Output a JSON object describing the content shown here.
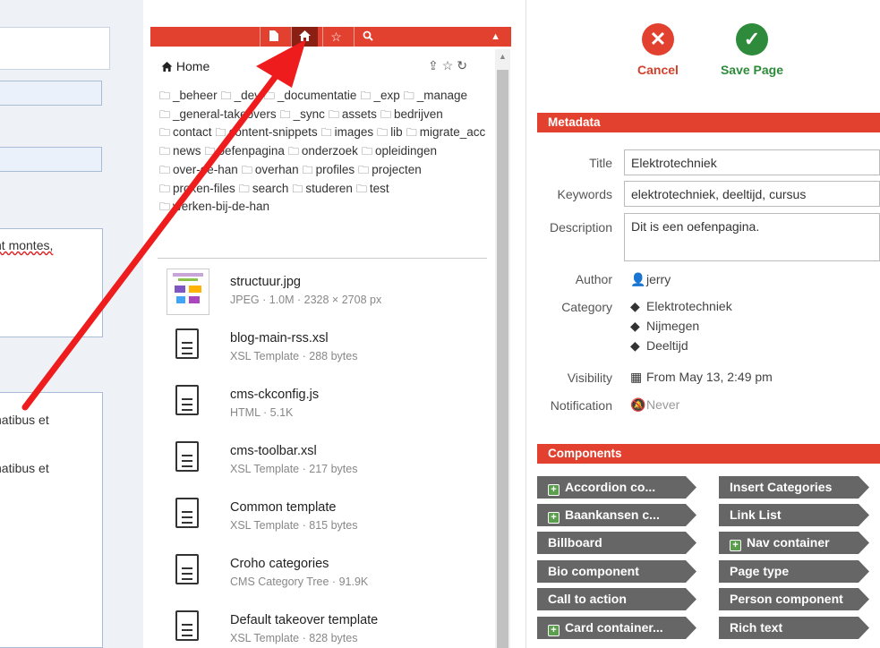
{
  "left_panel": {
    "text_1": "nt montes,",
    "text_2": "natibus et",
    "text_3": "natibus et"
  },
  "toolbar": {
    "buttons": [
      "file-icon",
      "home-icon",
      "star-icon",
      "search-icon"
    ],
    "active": "home-icon",
    "collapse_icon": "chevron-up-icon",
    "color": "#e2412f"
  },
  "file_browser": {
    "home_label": "Home",
    "folders": [
      "_beheer",
      "_dev",
      "_documentatie",
      "_exp",
      "_manage",
      "_general-takeovers",
      "_sync",
      "assets",
      "bedrijven",
      "contact",
      "content-snippets",
      "images",
      "lib",
      "migrate_acc",
      "news",
      "oefenpagina",
      "onderzoek",
      "opleidingen",
      "over-de-han",
      "overhan",
      "profiles",
      "projecten",
      "proxen-files",
      "search",
      "studeren",
      "test",
      "werken-bij-de-han"
    ],
    "files": [
      {
        "name": "structuur.jpg",
        "meta": "JPEG · 1.0M · 2328 × 2708 px",
        "thumb": true
      },
      {
        "name": "blog-main-rss.xsl",
        "meta": "XSL Template · 288 bytes"
      },
      {
        "name": "cms-ckconfig.js",
        "meta": "HTML · 5.1K"
      },
      {
        "name": "cms-toolbar.xsl",
        "meta": "XSL Template · 217 bytes"
      },
      {
        "name": "Common template",
        "meta": "XSL Template · 815 bytes"
      },
      {
        "name": "Croho categories",
        "meta": "CMS Category Tree · 91.9K"
      },
      {
        "name": "Default takeover template",
        "meta": "XSL Template · 828 bytes"
      }
    ]
  },
  "actions": {
    "cancel_label": "Cancel",
    "save_label": "Save Page",
    "cancel_color": "#e2412f",
    "save_color": "#2e8b3c"
  },
  "metadata": {
    "header": "Metadata",
    "title_label": "Title",
    "title_value": "Elektrotechniek",
    "keywords_label": "Keywords",
    "keywords_value": "elektrotechniek, deeltijd, cursus",
    "description_label": "Description",
    "description_value": "Dit is een oefenpagina.",
    "author_label": "Author",
    "author_value": "jerry",
    "category_label": "Category",
    "categories": [
      "Elektrotechniek",
      "Nijmegen",
      "Deeltijd"
    ],
    "visibility_label": "Visibility",
    "visibility_value": "From May 13, 2:49 pm",
    "notification_label": "Notification",
    "notification_value": "Never"
  },
  "components": {
    "header": "Components",
    "left": [
      {
        "label": "Accordion co...",
        "expandable": true
      },
      {
        "label": "Baankansen c...",
        "expandable": true
      },
      {
        "label": "Billboard",
        "expandable": false
      },
      {
        "label": "Bio component",
        "expandable": false
      },
      {
        "label": "Call to action",
        "expandable": false
      },
      {
        "label": "Card container...",
        "expandable": true
      }
    ],
    "right": [
      {
        "label": "Insert Categories",
        "expandable": false
      },
      {
        "label": "Link List",
        "expandable": false
      },
      {
        "label": "Nav container",
        "expandable": true
      },
      {
        "label": "Page type",
        "expandable": false
      },
      {
        "label": "Person component",
        "expandable": false
      },
      {
        "label": "Rich text",
        "expandable": false
      }
    ]
  }
}
